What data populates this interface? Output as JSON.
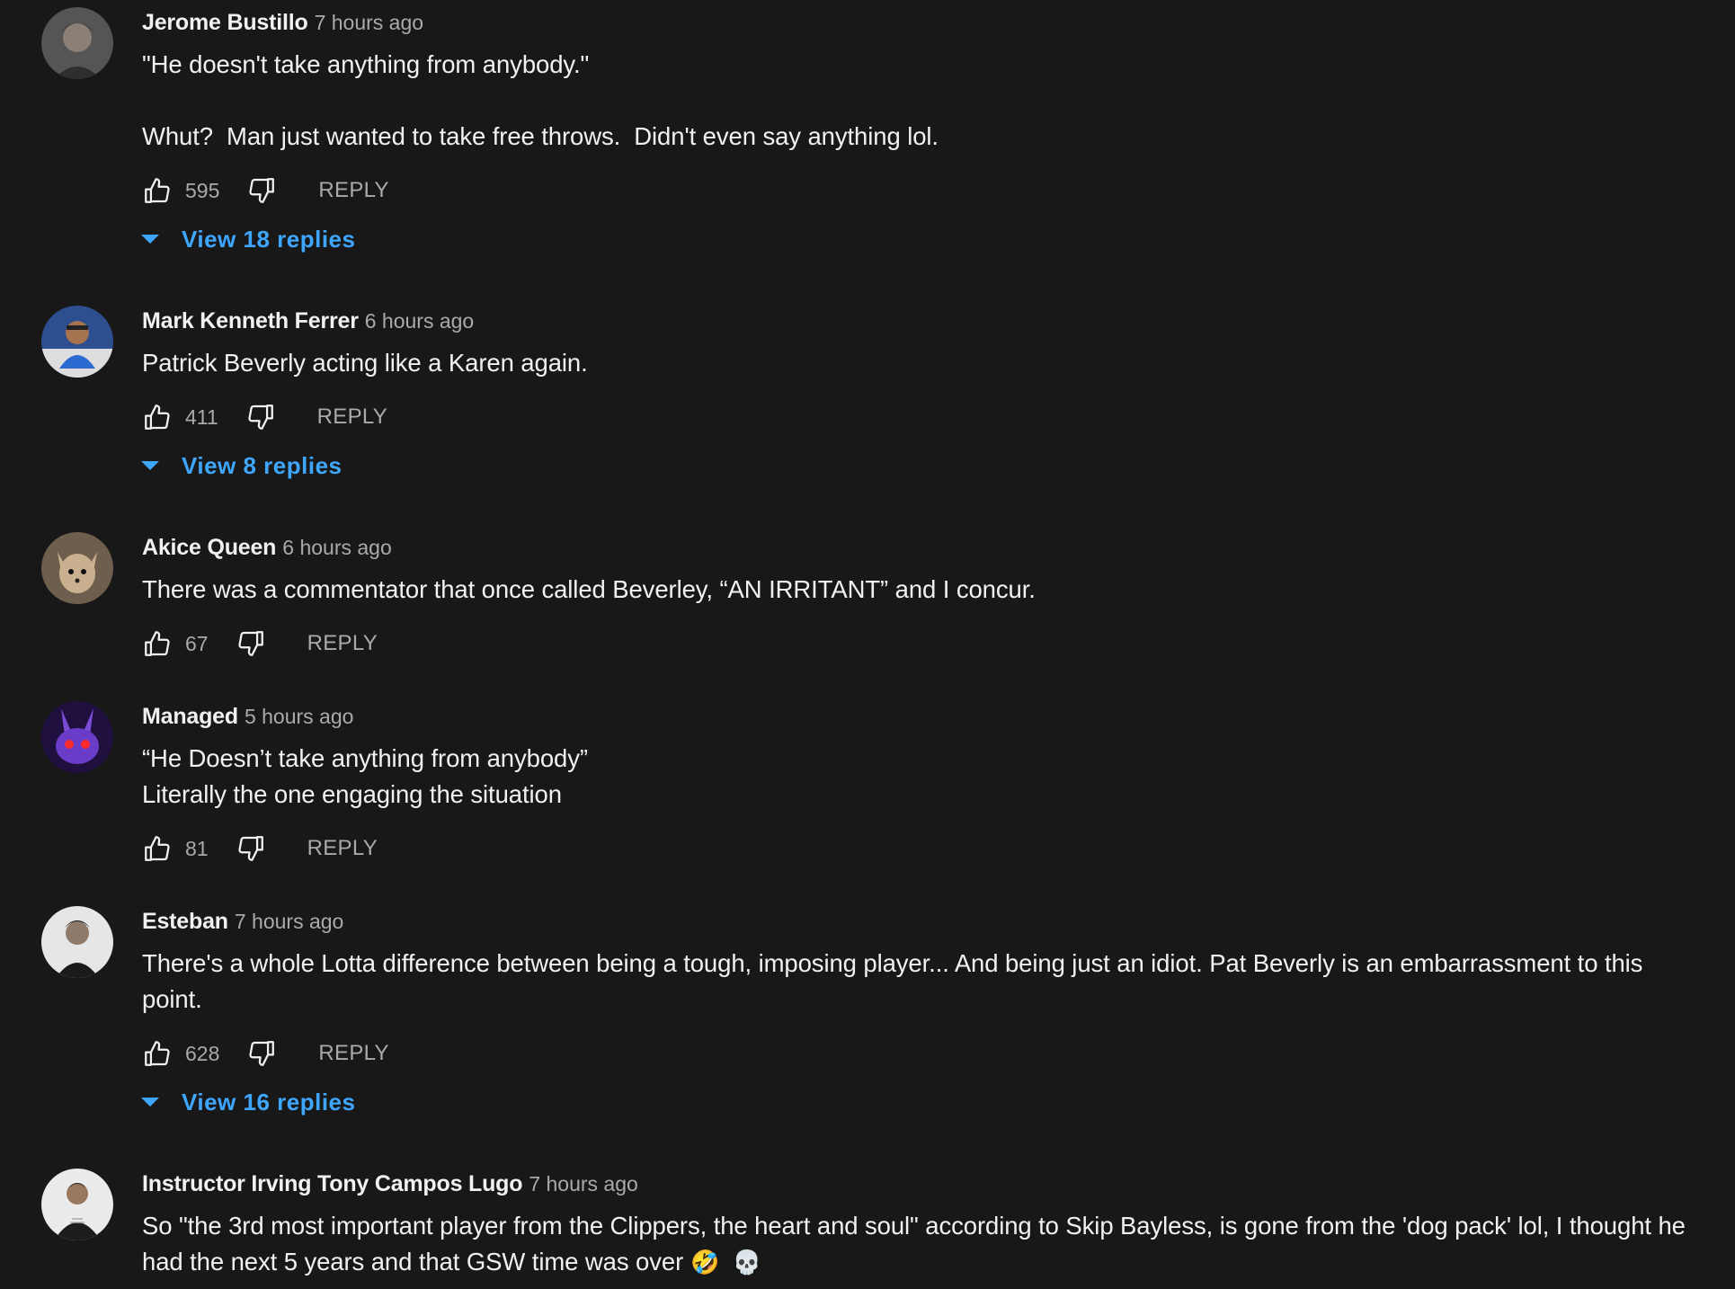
{
  "comments": [
    {
      "author": "Jerome Bustillo",
      "time": "7 hours ago",
      "text": "\"He doesn't take anything from anybody.\"\n\nWhut?  Man just wanted to take free throws.  Didn't even say anything lol.",
      "likes": "595",
      "reply_label": "REPLY",
      "view_replies": "View 18 replies",
      "avatar_color": "#5a5a5a"
    },
    {
      "author": "Mark Kenneth Ferrer",
      "time": "6 hours ago",
      "text": "Patrick Beverly acting like a Karen again.",
      "likes": "411",
      "reply_label": "REPLY",
      "view_replies": "View 8 replies",
      "avatar_color": "#2d4f8f"
    },
    {
      "author": "Akice Queen",
      "time": "6 hours ago",
      "text": "There was a commentator that once called Beverley, “AN IRRITANT” and I concur.",
      "likes": "67",
      "reply_label": "REPLY",
      "avatar_color": "#7a6652"
    },
    {
      "author": "Managed",
      "time": "5 hours ago",
      "text": "“He Doesn’t take anything from anybody”\nLiterally the one engaging the situation",
      "likes": "81",
      "reply_label": "REPLY",
      "avatar_color": "#3a1d6e"
    },
    {
      "author": "Esteban",
      "time": "7 hours ago",
      "text": "There's a whole Lotta difference between being a tough, imposing player... And being just an idiot. Pat Beverly is an embarrassment to this point.",
      "likes": "628",
      "reply_label": "REPLY",
      "view_replies": "View 16 replies",
      "avatar_color": "#d9d9d9"
    },
    {
      "author": "Instructor Irving Tony Campos Lugo",
      "time": "7 hours ago",
      "text": "So \"the 3rd most important player from the Clippers, the heart and soul\" according to Skip Bayless, is gone from the 'dog pack' lol, I thought he had the next 5 years and that GSW time was over",
      "emoji": "🤣  💀",
      "avatar_color": "#e8e8e8"
    }
  ],
  "icons": {
    "like": "thumbs-up-icon",
    "dislike": "thumbs-down-icon",
    "expand": "caret-down-icon"
  },
  "colors": {
    "background": "#181818",
    "link": "#3ea6ff",
    "secondary_text": "#aaaaaa"
  }
}
